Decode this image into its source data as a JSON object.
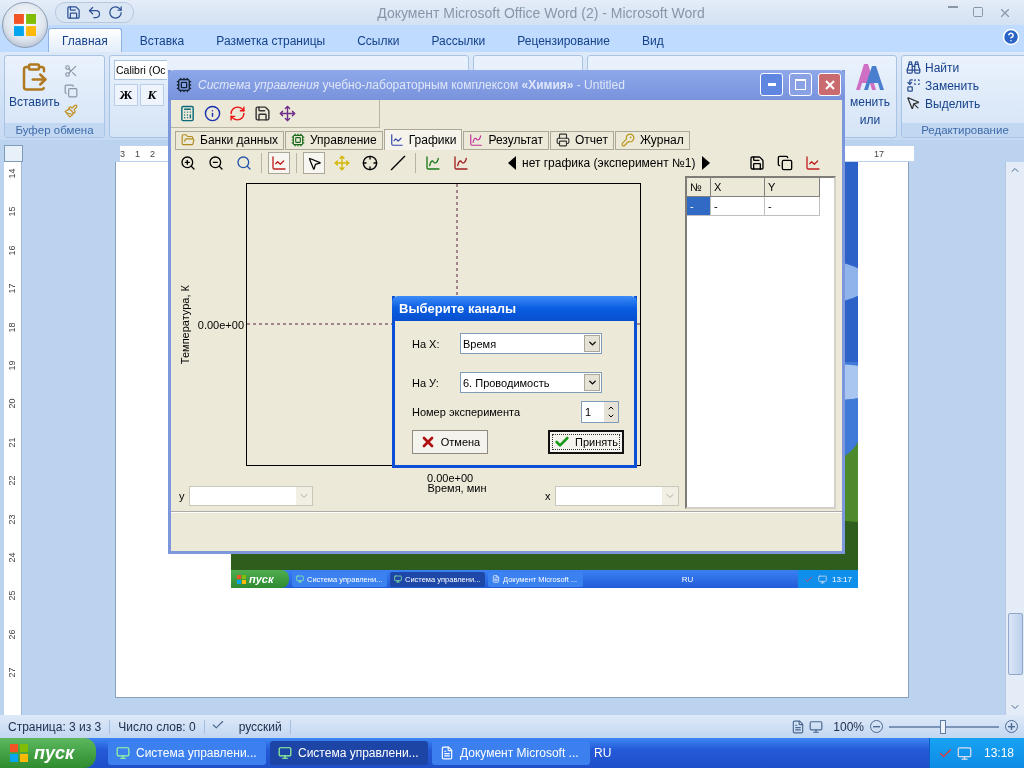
{
  "word": {
    "title": "Документ Microsoft Office Word (2) - Microsoft Word",
    "tabs": [
      {
        "label": "Главная",
        "selected": true
      },
      {
        "label": "Вставка",
        "selected": false
      },
      {
        "label": "Разметка страницы",
        "selected": false
      },
      {
        "label": "Ссылки",
        "selected": false
      },
      {
        "label": "Рассылки",
        "selected": false
      },
      {
        "label": "Рецензирование",
        "selected": false
      },
      {
        "label": "Вид",
        "selected": false
      }
    ],
    "ribbon": {
      "paste": "Вставить",
      "clipboard_group": "Буфер обмена",
      "font_name": "Calibri (Oc",
      "bold": "Ж",
      "italic": "К",
      "styles_button": [
        "менить",
        "или"
      ],
      "find": "Найти",
      "replace": "Заменить",
      "select": "Выделить",
      "editing_group": "Редактирование"
    },
    "ruler": {
      "left_marks": [
        "3",
        "1",
        "2"
      ],
      "right_mark": "17"
    },
    "vertical_ruler": [
      "14",
      "15",
      "16",
      "17",
      "18",
      "19",
      "20",
      "21",
      "22",
      "23",
      "24",
      "25",
      "26",
      "27"
    ],
    "document": {
      "screenshot": {
        "taskbar": {
          "start": "пуск",
          "buttons": [
            {
              "label": "Система управлени...",
              "selected": false
            },
            {
              "label": "Система управлени...",
              "selected": true
            },
            {
              "label": "Документ Microsoft ...",
              "selected": false
            }
          ],
          "language": "RU",
          "clock": "13:17"
        }
      }
    },
    "status_bar": {
      "page": "Страница: 3 из 3",
      "words": "Число слов: 0",
      "language": "русский",
      "zoom": "100%",
      "zoom_slider": {
        "level": 0.5
      }
    }
  },
  "app_window": {
    "title": "*Система управления* учебно-лабораторным комплексом **«Химия»** - Untitled",
    "tabs": [
      {
        "label": "Банки данных",
        "selected": false
      },
      {
        "label": "Управление",
        "selected": false
      },
      {
        "label": "Графики",
        "selected": true
      },
      {
        "label": "Результат",
        "selected": false
      },
      {
        "label": "Отчет",
        "selected": false
      },
      {
        "label": "Журнал",
        "selected": false
      }
    ],
    "chart_toolbar": {
      "graph_label": "нет графика (эксперимент №1)"
    },
    "plot": {
      "ylabel": "Температура, К",
      "ytick": "0.00e+00",
      "xtick": "0.00e+00",
      "xlabel": "Время, мин"
    },
    "y_combo": {
      "label": "y",
      "disabled": true
    },
    "x_combo": {
      "label": "x",
      "disabled": true
    },
    "table": {
      "columns": [
        "№",
        "X",
        "Y"
      ],
      "rows": [
        {
          "cells": [
            {
              "text": "-",
              "selected": true
            },
            {
              "text": "-",
              "selected": false
            },
            {
              "text": "-",
              "selected": false
            }
          ]
        }
      ]
    },
    "dialog": {
      "title": "Выберите каналы",
      "fields": [
        {
          "label": "На X:",
          "value": "Время"
        },
        {
          "label": "На У:",
          "value": "6. Проводимость"
        }
      ],
      "experiment": {
        "label": "Номер эксперимента",
        "value": "1"
      },
      "buttons": [
        {
          "kind": "cancel",
          "label": "Отмена",
          "default": false
        },
        {
          "kind": "accept",
          "label": "Принять",
          "default": true
        }
      ]
    }
  },
  "taskbar": {
    "start": "пуск",
    "buttons": [
      {
        "label": "Система управлени...",
        "selected": false
      },
      {
        "label": "Система управлени...",
        "selected": true
      },
      {
        "label": "Документ Microsoft ...",
        "selected": false
      }
    ],
    "language": "RU",
    "clock": "13:18"
  }
}
